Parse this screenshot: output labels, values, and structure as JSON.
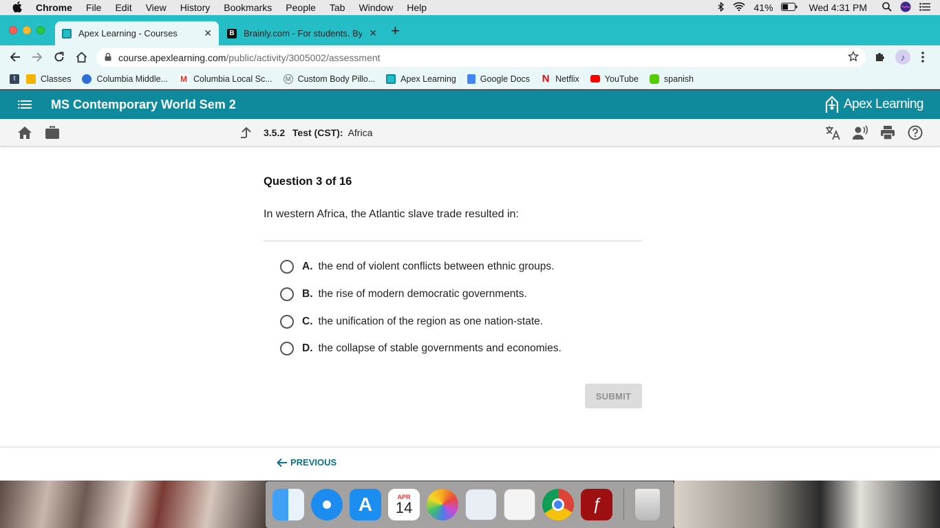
{
  "menubar": {
    "app": "Chrome",
    "items": [
      "File",
      "Edit",
      "View",
      "History",
      "Bookmarks",
      "People",
      "Tab",
      "Window",
      "Help"
    ],
    "battery": "41%",
    "clock": "Wed 4:31 PM"
  },
  "tabs": [
    {
      "title": "Apex Learning - Courses",
      "active": true
    },
    {
      "title": "Brainly.com - For students. By",
      "active": false
    }
  ],
  "omnibox": {
    "url_host": "course.apexlearning.com",
    "url_path": "/public/activity/3005002/assessment"
  },
  "bookmarks": [
    "Classes",
    "Columbia Middle...",
    "Columbia Local Sc...",
    "Custom Body Pillo...",
    "Apex Learning",
    "Google Docs",
    "Netflix",
    "YouTube",
    "spanish"
  ],
  "course": {
    "title": "MS Contemporary World Sem 2",
    "brand": "Apex Learning"
  },
  "activity": {
    "number": "3.5.2",
    "type": "Test (CST):",
    "name": "Africa"
  },
  "question": {
    "counter": "Question 3 of 16",
    "prompt": "In western Africa, the Atlantic slave trade resulted in:",
    "choices": [
      {
        "letter": "A.",
        "text": "the end of violent conflicts between ethnic groups."
      },
      {
        "letter": "B.",
        "text": "the rise of modern democratic governments."
      },
      {
        "letter": "C.",
        "text": "the unification of the region as one nation-state."
      },
      {
        "letter": "D.",
        "text": "the collapse of stable governments and economies."
      }
    ],
    "submit_label": "SUBMIT"
  },
  "footer": {
    "previous_label": "PREVIOUS"
  },
  "dock": {
    "calendar_month": "APR",
    "calendar_day": "14"
  },
  "colors": {
    "tabstrip": "#26bec6",
    "course_bar": "#0f8a9c",
    "link": "#0f6e86"
  },
  "icons": {
    "subbar_left": [
      "home-icon",
      "briefcase-icon"
    ],
    "subbar_right": [
      "translate-icon",
      "read-aloud-icon",
      "print-icon",
      "help-icon"
    ]
  }
}
